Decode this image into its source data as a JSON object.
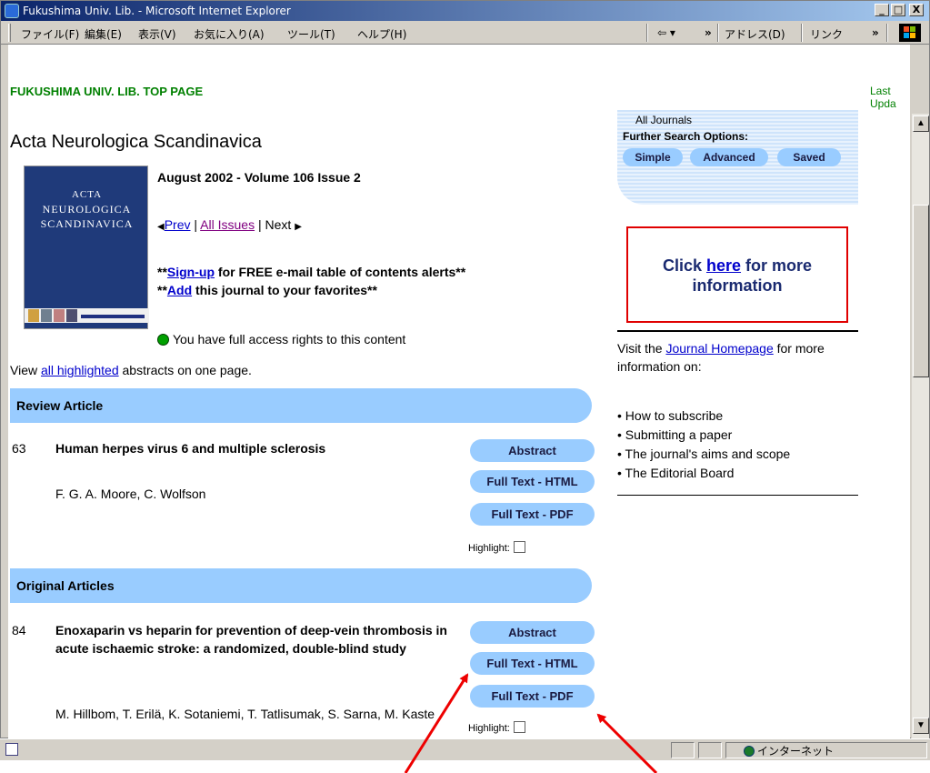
{
  "window": {
    "title": "Fukushima Univ. Lib. - Microsoft Internet Explorer",
    "controls": {
      "minimize": "_",
      "maximize": "□",
      "close": "X"
    }
  },
  "menubar": {
    "items": [
      "ファイル(F)",
      "編集(E)",
      "表示(V)",
      "お気に入り(A)",
      "ツール(T)",
      "ヘルプ(H)"
    ],
    "back_label": "⇦ ▾",
    "more": "»",
    "address_label": "アドレス(D)",
    "links_label": "リンク",
    "links_more": "»"
  },
  "topbar": {
    "library_link": "FUKUSHIMA UNIV. LIB. TOP PAGE",
    "last_updated": "Last Upda"
  },
  "journal": {
    "title": "Acta Neurologica Scandinavica",
    "cover": {
      "line1": "ACTA",
      "line2": "NEUROLOGICA",
      "line3": "SCANDINAVICA"
    },
    "issue": "August 2002 - Volume 106 Issue 2",
    "nav": {
      "prev": "Prev",
      "sep1": " | ",
      "all_issues": "All Issues",
      "sep2": " | ",
      "next": "Next"
    },
    "alerts": {
      "signup_prefix": "**",
      "signup_link": "Sign-up",
      "signup_suffix": " for FREE e-mail table of contents alerts**",
      "add_prefix": "**",
      "add_link": "Add",
      "add_suffix": " this journal to your favorites**"
    },
    "access_text": "You have full access rights to this content",
    "view_prefix": "View ",
    "view_link": "all highlighted",
    "view_suffix": " abstracts on one page."
  },
  "sections": [
    {
      "heading": "Review Article",
      "articles": [
        {
          "number": "63",
          "title": "Human herpes virus 6 and multiple sclerosis",
          "authors": "F. G. A. Moore, C. Wolfson",
          "buttons": [
            "Abstract",
            "Full Text - HTML",
            "Full Text - PDF"
          ],
          "highlight_label": "Highlight:"
        }
      ]
    },
    {
      "heading": "Original Articles",
      "articles": [
        {
          "number": "84",
          "title": "Enoxaparin vs heparin for prevention of deep-vein thrombosis in acute ischaemic stroke: a randomized, double-blind study",
          "authors": "M. Hillbom, T. Erilä, K. Sotaniemi, T. Tatlisumak, S. Sarna, M. Kaste",
          "buttons": [
            "Abstract",
            "Full Text - HTML",
            "Full Text - PDF"
          ],
          "highlight_label": "Highlight:"
        }
      ]
    }
  ],
  "sidebar": {
    "all_journals": "All Journals",
    "further_search": "Further Search Options:",
    "search_buttons": [
      "Simple",
      "Advanced",
      "Saved"
    ],
    "promo": {
      "prefix": "Click ",
      "link": "here",
      "suffix": " for more",
      "line2": "information"
    },
    "visit": {
      "prefix": "Visit the ",
      "link": "Journal Homepage",
      "suffix": " for more information on:"
    },
    "bullets": [
      "• How to subscribe",
      "• Submitting a paper",
      "• The journal's aims and scope",
      "• The Editorial Board"
    ]
  },
  "statusbar": {
    "zone": "インターネット"
  },
  "colors": {
    "section_bar": "#99ccff",
    "pill": "#99ccff",
    "library_link": "#008000",
    "annotation_arrow": "#ee0000",
    "promo_border": "#e00000"
  }
}
